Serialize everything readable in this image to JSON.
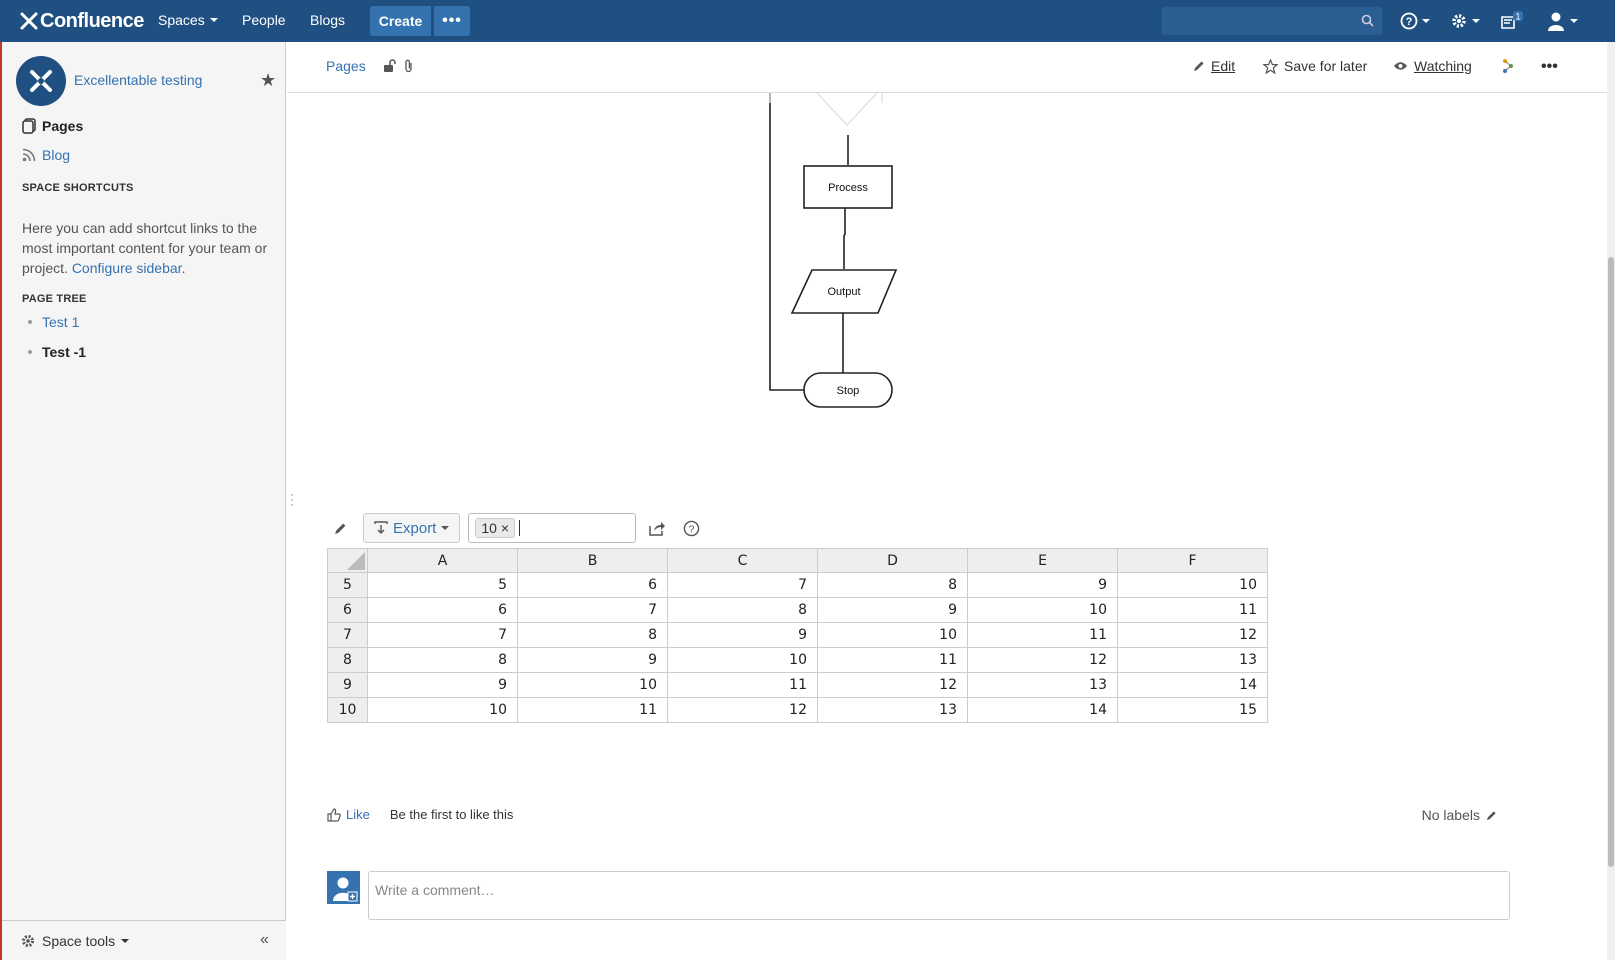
{
  "topnav": {
    "logo": "Confluence",
    "spaces": "Spaces",
    "people": "People",
    "blogs": "Blogs",
    "create": "Create",
    "notification_count": "1"
  },
  "sidebar": {
    "space_name": "Excellentable testing",
    "pages": "Pages",
    "blog": "Blog",
    "shortcuts_heading": "SPACE SHORTCUTS",
    "shortcuts_text": "Here you can add shortcut links to the most important content for your team or project.",
    "configure_link": "Configure sidebar",
    "page_tree_heading": "PAGE TREE",
    "tree": [
      "Test 1",
      "Test -1"
    ],
    "space_tools": "Space tools"
  },
  "header": {
    "breadcrumb": "Pages",
    "edit": "Edit",
    "save_for_later": "Save for later",
    "watching": "Watching"
  },
  "flowchart": {
    "nodes": [
      "Process",
      "Output",
      "Stop"
    ]
  },
  "sheet": {
    "export": "Export",
    "filter_tag": "10 ×",
    "columns": [
      "A",
      "B",
      "C",
      "D",
      "E",
      "F"
    ],
    "rows": [
      {
        "label": "5",
        "cells": [
          "5",
          "6",
          "7",
          "8",
          "9",
          "10"
        ]
      },
      {
        "label": "6",
        "cells": [
          "6",
          "7",
          "8",
          "9",
          "10",
          "11"
        ]
      },
      {
        "label": "7",
        "cells": [
          "7",
          "8",
          "9",
          "10",
          "11",
          "12"
        ]
      },
      {
        "label": "8",
        "cells": [
          "8",
          "9",
          "10",
          "11",
          "12",
          "13"
        ]
      },
      {
        "label": "9",
        "cells": [
          "9",
          "10",
          "11",
          "12",
          "13",
          "14"
        ]
      },
      {
        "label": "10",
        "cells": [
          "10",
          "11",
          "12",
          "13",
          "14",
          "15"
        ]
      }
    ]
  },
  "footer": {
    "like": "Like",
    "like_text": "Be the first to like this",
    "labels": "No labels",
    "comment_placeholder": "Write a comment…"
  }
}
